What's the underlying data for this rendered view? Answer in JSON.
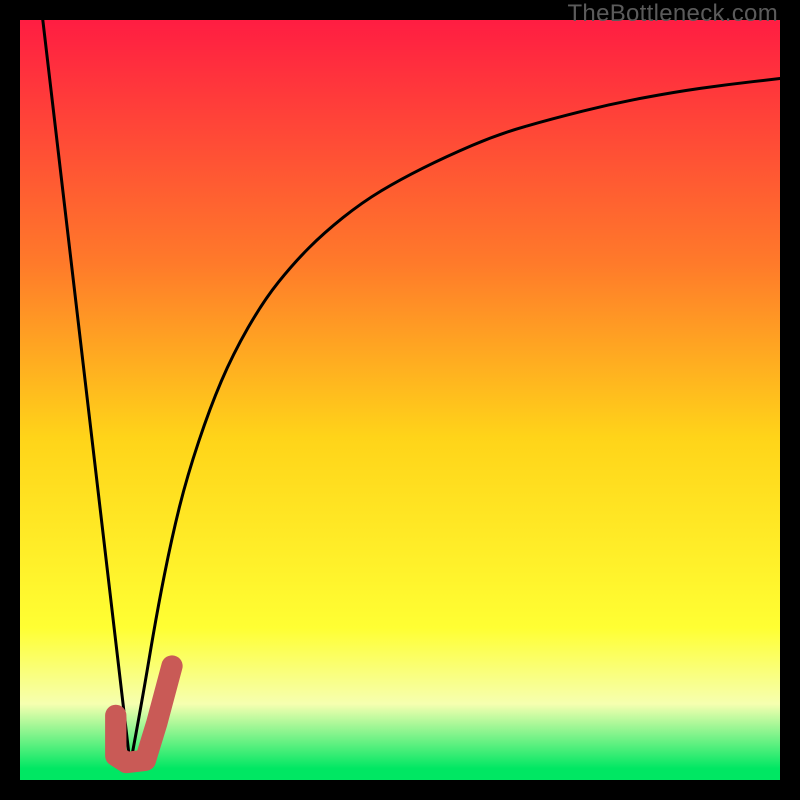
{
  "watermark": "TheBottleneck.com",
  "colors": {
    "gradient_top": "#ff1d42",
    "gradient_mid1": "#ff7a2a",
    "gradient_mid2": "#ffd419",
    "gradient_mid3": "#ffff33",
    "gradient_bottom_pale": "#f6ffb0",
    "gradient_green": "#00e763",
    "curve": "#000000",
    "marker": "#c95a56",
    "frame": "#000000"
  },
  "chart_data": {
    "type": "line",
    "title": "",
    "xlabel": "",
    "ylabel": "",
    "xlim": [
      0,
      100
    ],
    "ylim": [
      0,
      100
    ],
    "series": [
      {
        "name": "left-line",
        "x": [
          3,
          14.5
        ],
        "y": [
          100,
          2
        ]
      },
      {
        "name": "right-curve",
        "x": [
          14.5,
          16,
          18,
          20,
          22,
          25,
          28,
          32,
          36,
          40,
          45,
          50,
          56,
          63,
          70,
          78,
          86,
          93,
          100
        ],
        "y": [
          2,
          10,
          22,
          32,
          40,
          49,
          56,
          63,
          68,
          72,
          76,
          79,
          82,
          85,
          87,
          89,
          90.5,
          91.5,
          92.3
        ]
      }
    ],
    "marker": {
      "name": "J-marker",
      "shape": "rounded-J",
      "color": "#c95a56",
      "stroke_width_pct": 2.8,
      "points_xy": [
        [
          12.6,
          8.5
        ],
        [
          12.6,
          3.2
        ],
        [
          14.0,
          2.3
        ],
        [
          16.5,
          2.6
        ],
        [
          18.0,
          7.5
        ],
        [
          20.0,
          15.0
        ]
      ]
    },
    "background_gradient": {
      "stops": [
        {
          "offset": 0.0,
          "color": "#ff1d42"
        },
        {
          "offset": 0.32,
          "color": "#ff7a2a"
        },
        {
          "offset": 0.55,
          "color": "#ffd419"
        },
        {
          "offset": 0.8,
          "color": "#ffff33"
        },
        {
          "offset": 0.9,
          "color": "#f6ffb0"
        },
        {
          "offset": 0.985,
          "color": "#00e763"
        }
      ]
    }
  }
}
